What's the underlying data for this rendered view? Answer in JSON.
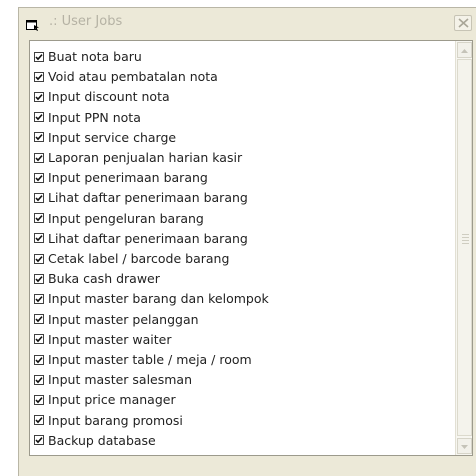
{
  "window": {
    "title": ".: User Jobs",
    "icons": {
      "app": "window-icon",
      "close": "close-icon"
    }
  },
  "list": {
    "items": [
      {
        "label": "Buat nota baru",
        "checked": true
      },
      {
        "label": "Void atau pembatalan nota",
        "checked": true
      },
      {
        "label": "Input discount nota",
        "checked": true
      },
      {
        "label": "Input PPN nota",
        "checked": true
      },
      {
        "label": "Input service charge",
        "checked": true
      },
      {
        "label": "Laporan penjualan harian kasir",
        "checked": true
      },
      {
        "label": "Input penerimaan barang",
        "checked": true
      },
      {
        "label": "Lihat daftar penerimaan barang",
        "checked": true
      },
      {
        "label": "Input pengeluran barang",
        "checked": true
      },
      {
        "label": "Lihat daftar penerimaan barang",
        "checked": true
      },
      {
        "label": "Cetak label / barcode barang",
        "checked": true
      },
      {
        "label": "Buka cash drawer",
        "checked": true
      },
      {
        "label": "Input master barang dan kelompok",
        "checked": true
      },
      {
        "label": "Input master pelanggan",
        "checked": true
      },
      {
        "label": "Input master waiter",
        "checked": true
      },
      {
        "label": "Input master table / meja / room",
        "checked": true
      },
      {
        "label": "Input master salesman",
        "checked": true
      },
      {
        "label": "Input price manager",
        "checked": true
      },
      {
        "label": "Input barang promosi",
        "checked": true
      },
      {
        "label": "Backup database",
        "checked": true
      }
    ]
  },
  "colors": {
    "window_bg": "#ece9d8",
    "list_bg": "#ffffff",
    "title_text": "#b5b2a4"
  }
}
